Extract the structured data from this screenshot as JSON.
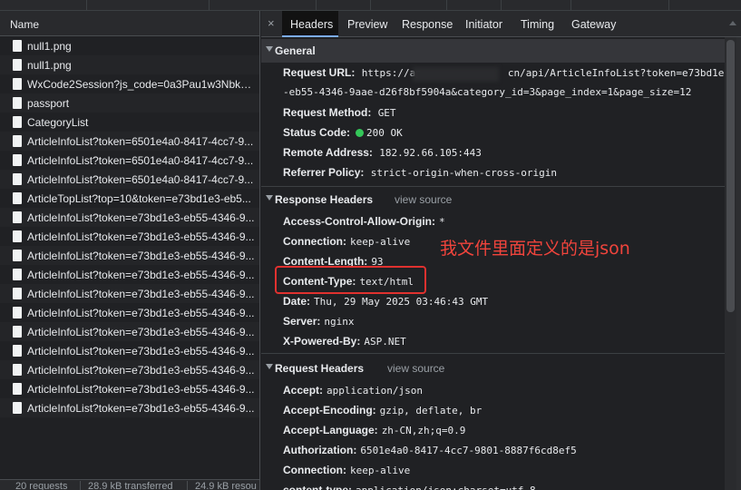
{
  "left": {
    "header": "Name",
    "requests": [
      "null1.png",
      "null1.png",
      "WxCode2Session?js_code=0a3Pau1w3NbkY4...",
      "passport",
      "CategoryList",
      "ArticleInfoList?token=6501e4a0-8417-4cc7-9...",
      "ArticleInfoList?token=6501e4a0-8417-4cc7-9...",
      "ArticleInfoList?token=6501e4a0-8417-4cc7-9...",
      "ArticleTopList?top=10&token=e73bd1e3-eb5...",
      "ArticleInfoList?token=e73bd1e3-eb55-4346-9...",
      "ArticleInfoList?token=e73bd1e3-eb55-4346-9...",
      "ArticleInfoList?token=e73bd1e3-eb55-4346-9...",
      "ArticleInfoList?token=e73bd1e3-eb55-4346-9...",
      "ArticleInfoList?token=e73bd1e3-eb55-4346-9...",
      "ArticleInfoList?token=e73bd1e3-eb55-4346-9...",
      "ArticleInfoList?token=e73bd1e3-eb55-4346-9...",
      "ArticleInfoList?token=e73bd1e3-eb55-4346-9...",
      "ArticleInfoList?token=e73bd1e3-eb55-4346-9...",
      "ArticleInfoList?token=e73bd1e3-eb55-4346-9...",
      "ArticleInfoList?token=e73bd1e3-eb55-4346-9..."
    ],
    "status": {
      "requests": "20 requests",
      "transferred": "28.9 kB transferred",
      "resources": "24.9 kB resou"
    }
  },
  "tabs": {
    "close": "×",
    "items": [
      "Headers",
      "Preview",
      "Response",
      "Initiator",
      "Timing",
      "Gateway"
    ],
    "active": "Headers"
  },
  "general": {
    "title": "General",
    "request_url_label": "Request URL:",
    "request_url_value_1": "https://ap",
    "request_url_value_1b": "cn/api/ArticleInfoList?token=e73bd1e3",
    "request_url_value_2": "-eb55-4346-9aae-d26f8bf5904a&category_id=3&page_index=1&page_size=12",
    "method_label": "Request Method:",
    "method_value": "GET",
    "status_label": "Status Code:",
    "status_value": "200 OK",
    "remote_label": "Remote Address:",
    "remote_value": "182.92.66.105:443",
    "referrer_label": "Referrer Policy:",
    "referrer_value": "strict-origin-when-cross-origin"
  },
  "response_headers": {
    "title": "Response Headers",
    "view_source": "view source",
    "rows": [
      {
        "k": "Access-Control-Allow-Origin:",
        "v": "*"
      },
      {
        "k": "Connection:",
        "v": "keep-alive"
      },
      {
        "k": "Content-Length:",
        "v": "93"
      },
      {
        "k": "Content-Type:",
        "v": "text/html"
      },
      {
        "k": "Date:",
        "v": "Thu, 29 May 2025 03:46:43 GMT"
      },
      {
        "k": "Server:",
        "v": "nginx"
      },
      {
        "k": "X-Powered-By:",
        "v": "ASP.NET"
      }
    ]
  },
  "request_headers": {
    "title": "Request Headers",
    "view_source": "view source",
    "rows": [
      {
        "k": "Accept:",
        "v": "application/json"
      },
      {
        "k": "Accept-Encoding:",
        "v": "gzip, deflate, br"
      },
      {
        "k": "Accept-Language:",
        "v": "zh-CN,zh;q=0.9"
      },
      {
        "k": "Authorization:",
        "v": "6501e4a0-8417-4cc7-9801-8887f6cd8ef5"
      },
      {
        "k": "Connection:",
        "v": "keep-alive"
      },
      {
        "k": "content-type:",
        "v": "application/json;charset=utf-8"
      }
    ]
  },
  "annotation": {
    "text": "我文件里面定义的是json",
    "color": "#e0312f"
  },
  "colors": {
    "accent": "#7cacf8",
    "status_ok": "#34c759"
  }
}
